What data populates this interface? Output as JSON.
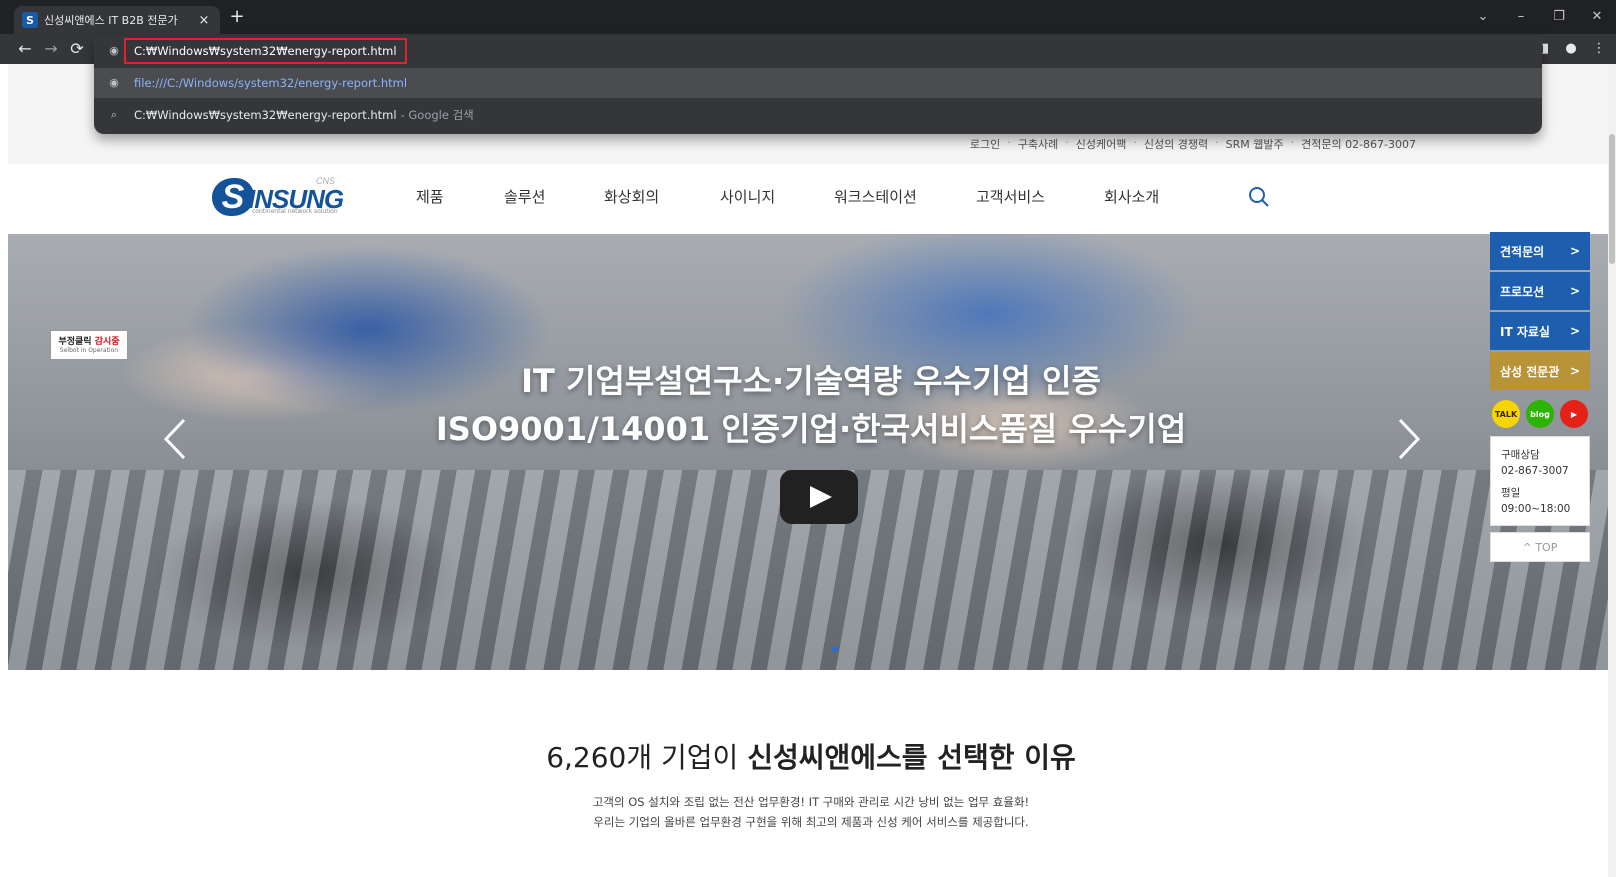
{
  "browser": {
    "tab_title": "신성씨앤에스 IT B2B 전문가",
    "tab_favicon": "S",
    "tab_close": "×",
    "new_tab": "+",
    "window_controls": [
      "⌄",
      "–",
      "❐",
      "✕"
    ],
    "omnibox_text": "C:₩Windows₩system32₩energy-report.html",
    "suggestions": [
      {
        "text": "file:///C:/Windows/system32/energy-report.html",
        "icon": "globe-icon"
      },
      {
        "text": "C:₩Windows₩system32₩energy-report.html",
        "sub": "- Google 검색",
        "icon": "search-icon"
      }
    ]
  },
  "site": {
    "util_links": [
      "로그인",
      "구축사례",
      "신성케어팩",
      "신성의 경쟁력",
      "SRM 웹발주",
      "견적문의 02-867-3007"
    ],
    "logo_letter": "S",
    "logo_text": "INSUNG",
    "logo_cns": "CNS",
    "logo_sub": "continental network solution",
    "nav": [
      "제품",
      "솔루션",
      "화상회의",
      "사이니지",
      "워크스테이션",
      "고객서비스",
      "회사소개"
    ]
  },
  "hero": {
    "line1": "IT 기업부설연구소·기술역량 우수기업 인증",
    "line2": "ISO9001/14001 인증기업·한국서비스품질 우수기업",
    "badge_line1_a": "부정클릭 ",
    "badge_line1_b": "감시중",
    "badge_line2": "Selbot in Operation"
  },
  "quick": {
    "buttons": [
      {
        "label": "견적문의",
        "color": "#1d5fae"
      },
      {
        "label": "프로모션",
        "color": "#1d5fae"
      },
      {
        "label": "IT 자료실",
        "color": "#1d5fae"
      },
      {
        "label": "삼성 전문관",
        "color": "#b89337"
      }
    ],
    "arrow": ">",
    "social": [
      "TALK",
      "blog",
      "▶"
    ],
    "contact_label": "구매상담",
    "contact_phone": "02-867-3007",
    "hours_label": "평일",
    "hours": "09:00~18:00",
    "top_label": "^ TOP"
  },
  "reason": {
    "title_prefix": "6,260개 기업이 ",
    "title_bold": "신성씨앤에스를 선택한 이유",
    "desc1": "고객의 OS 설치와 조립 없는 전산 업무환경! IT 구매와 관리로 시간 낭비 없는 업무 효율화!",
    "desc2": "우리는 기업의 올바른 업무환경 구현을 위해 최고의 제품과 신성 케어 서비스를 제공합니다."
  },
  "colors": {
    "brand": "#14539a",
    "quick_blue": "#1d5fae",
    "quick_gold": "#b89337",
    "omnibox_highlight": "#e0222b"
  }
}
